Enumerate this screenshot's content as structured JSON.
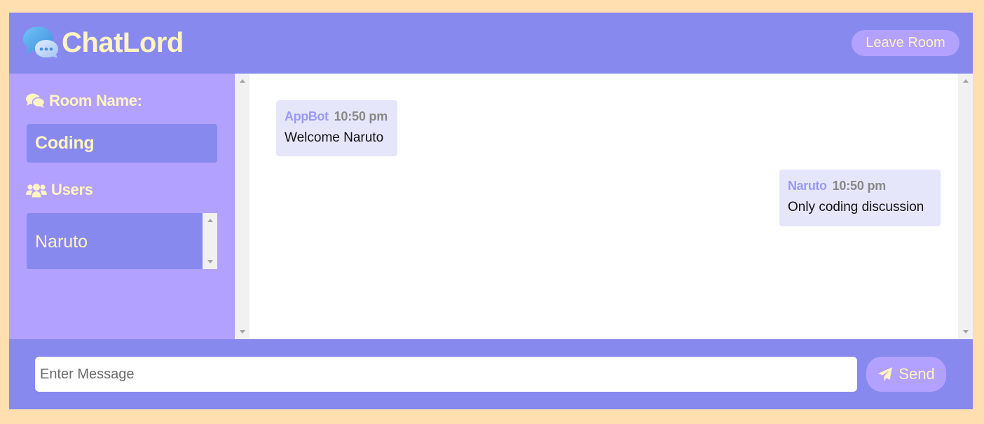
{
  "app": {
    "title": "ChatLord",
    "logo_icon": "chat-bubbles-icon"
  },
  "header": {
    "leave_label": "Leave Room"
  },
  "sidebar": {
    "room_heading": "Room Name:",
    "room_name": "Coding",
    "users_heading": "Users",
    "users": [
      "Naruto"
    ]
  },
  "messages": [
    {
      "user": "AppBot",
      "time": "10:50 pm",
      "text": "Welcome Naruto"
    },
    {
      "user": "Naruto",
      "time": "10:50 pm",
      "text": "Only coding discussion"
    }
  ],
  "composer": {
    "placeholder": "Enter Message",
    "send_label": "Send",
    "send_icon": "paper-plane-icon"
  },
  "colors": {
    "page_bg": "#FFDEAF",
    "primary": "#8789EE",
    "secondary": "#B3A1FF",
    "accent_text": "#FFF4C2",
    "message_bg": "#E6E6FB",
    "username": "#989BF4"
  }
}
